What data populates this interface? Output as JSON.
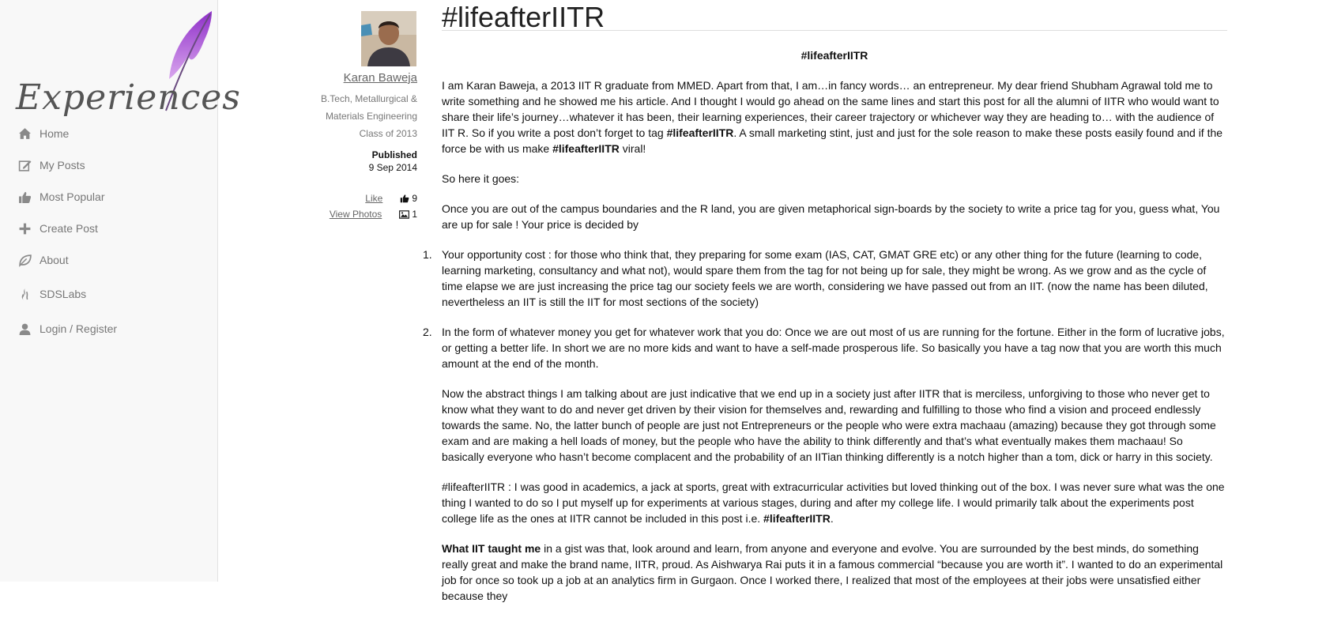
{
  "sidebar": {
    "logo_text": "Experiences",
    "nav": [
      {
        "label": "Home",
        "icon": "home-icon"
      },
      {
        "label": "My Posts",
        "icon": "edit-icon"
      },
      {
        "label": "Most Popular",
        "icon": "thumbs-up-icon"
      },
      {
        "label": "Create Post",
        "icon": "plus-icon"
      },
      {
        "label": "About",
        "icon": "leaf-icon"
      },
      {
        "label": "SDSLabs",
        "icon": "flame-icon"
      },
      {
        "label": "Login / Register",
        "icon": "user-icon"
      }
    ]
  },
  "author": {
    "name": "Karan Baweja",
    "degree_line1": "B.Tech, Metallurgical &",
    "degree_line2": "Materials Engineering",
    "class": "Class of 2013",
    "published_label": "Published",
    "published_date": "9 Sep 2014",
    "like_label": "Like",
    "like_count": "9",
    "photos_label": "View Photos",
    "photos_count": "1"
  },
  "post": {
    "title": "#lifeafterIITR",
    "center_tag": "#lifeafterIITR",
    "p1_a": "I am Karan Baweja, a 2013 IIT R graduate from MMED. Apart from that, I am…in fancy words… an entrepreneur. My dear friend Shubham Agrawal told me to write something and he showed me his article. And I thought I would go ahead on the same lines and start this post for all the alumni of IITR who would want to share their life’s journey…whatever it has been, their learning experiences, their career trajectory or whichever way they are heading to… with the audience of IIT R. So if you write a post don’t forget to tag ",
    "p1_tag1": "#lifeafterIITR",
    "p1_b": ".  A small marketing stint, just and just for the sole reason to make these posts easily found and if the force be with us make ",
    "p1_tag2": "#lifeafterIITR",
    "p1_c": " viral!",
    "p2": "So here it goes:",
    "p3": "Once you are out of the campus boundaries and the R land, you are given metaphorical sign-boards by the society to write a price tag for you, guess what, You are up for sale ! Your price is decided by",
    "li1_num": "1.",
    "li1": "   Your opportunity cost :  for those who think that, they preparing for some exam (IAS, CAT, GMAT GRE etc) or any other thing for the future (learning to code, learning marketing, consultancy and what not), would spare them from the tag for not being up for sale, they might be wrong. As we grow and as the cycle of time elapse we are just increasing the price tag our society feels we are worth, considering we have passed out from an IIT. (now the name has been diluted, nevertheless an IIT is still the IIT for most sections of the society)",
    "li2_num": "2.",
    "li2": "   In the form of whatever money you get for whatever work that you do: Once we are out most of us are running for the fortune. Either in the form of lucrative jobs, or getting a better life. In short we are no more kids and want to have a self-made prosperous life.  So basically you have a tag now that you are worth this much amount at the end of the month.",
    "p4": "Now the abstract things I am talking about are just indicative that we end up in a society just after IITR that is merciless, unforgiving to those who never get to know what they want to do and never get driven by their vision for themselves and, rewarding and fulfilling to those who find a vision and proceed endlessly towards the same. No, the latter bunch of people are just not Entrepreneurs or the people who were extra machaau (amazing) because they got through some exam and are making a hell loads of money, but the people who have the ability to think differently and that’s what eventually makes them machaau! So basically everyone who hasn’t become complacent and the probability of an IITian thinking differently is a notch higher than a tom, dick or harry in this society.",
    "p5_a": "#lifeafterIITR : I was good in academics, a jack at sports, great with extracurricular activities but loved thinking out of the box. I was never sure what was the one thing I wanted to do so I put myself up for experiments at various stages, during and after my college life.  I would primarily talk about the experiments post college life as the ones at IITR cannot be included in this post i.e. ",
    "p5_tag": "#lifeafterIITR",
    "p5_b": ".",
    "p6_bold": "What IIT taught me",
    "p6": " in a gist was that, look around and learn, from anyone and everyone and evolve. You are surrounded by the best minds, do something really great and make the brand name, IITR, proud. As Aishwarya Rai puts it in a famous commercial “because you are worth it”.  I wanted to do an experimental job for once so took up a job at an analytics firm in Gurgaon. Once I worked there, I realized that most of the employees at their jobs were unsatisfied either because they"
  }
}
